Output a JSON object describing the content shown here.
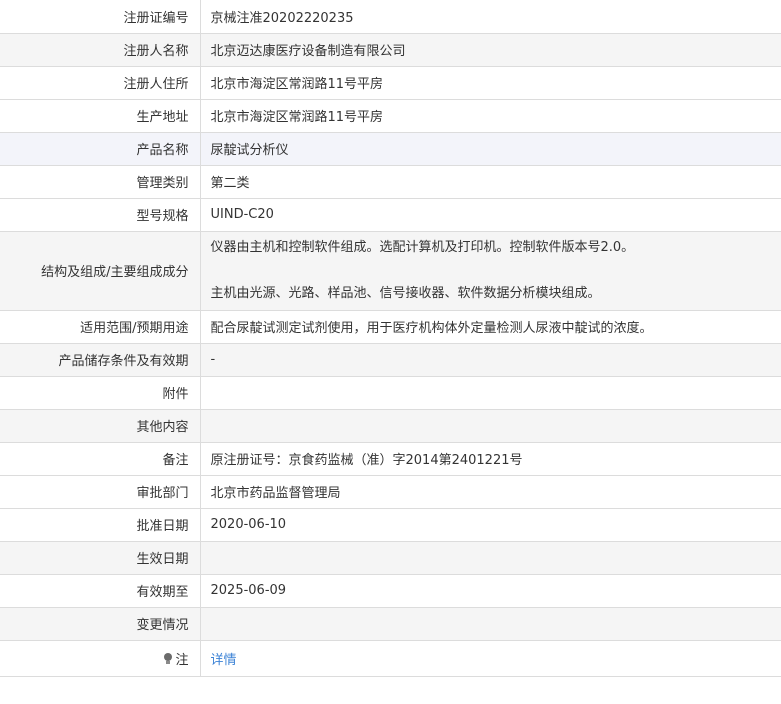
{
  "rows": [
    {
      "label": "注册证编号",
      "value": "京械注准20202220235"
    },
    {
      "label": "注册人名称",
      "value": "北京迈达康医疗设备制造有限公司"
    },
    {
      "label": "注册人住所",
      "value": "北京市海淀区常润路11号平房"
    },
    {
      "label": "生产地址",
      "value": "北京市海淀区常润路11号平房"
    },
    {
      "label": "产品名称",
      "value": "尿靛试分析仪"
    },
    {
      "label": "管理类别",
      "value": "第二类"
    },
    {
      "label": "型号规格",
      "value": "UIND-C20"
    },
    {
      "label": "结构及组成/主要组成成分",
      "value_line1": "仪器由主机和控制软件组成。选配计算机及打印机。控制软件版本号2.0。",
      "value_line2": "主机由光源、光路、样品池、信号接收器、软件数据分析模块组成。"
    },
    {
      "label": "适用范围/预期用途",
      "value": "配合尿靛试测定试剂使用，用于医疗机构体外定量检测人尿液中靛试的浓度。"
    },
    {
      "label": "产品储存条件及有效期",
      "value": "-"
    },
    {
      "label": "附件",
      "value": ""
    },
    {
      "label": "其他内容",
      "value": ""
    },
    {
      "label": "备注",
      "value": "原注册证号：京食药监械（准）字2014第2401221号"
    },
    {
      "label": "审批部门",
      "value": "北京市药品监督管理局"
    },
    {
      "label": "批准日期",
      "value": "2020-06-10"
    },
    {
      "label": "生效日期",
      "value": ""
    },
    {
      "label": "有效期至",
      "value": "2025-06-09"
    },
    {
      "label": "变更情况",
      "value": ""
    },
    {
      "label": "注",
      "value": "详情",
      "icon": "lightbulb-icon"
    }
  ],
  "colors": {
    "border": "#dcdcdc",
    "alt_row": "#f5f5f5",
    "highlight_row": "#f3f4fa",
    "link": "#3c83d6",
    "text": "#333333"
  }
}
